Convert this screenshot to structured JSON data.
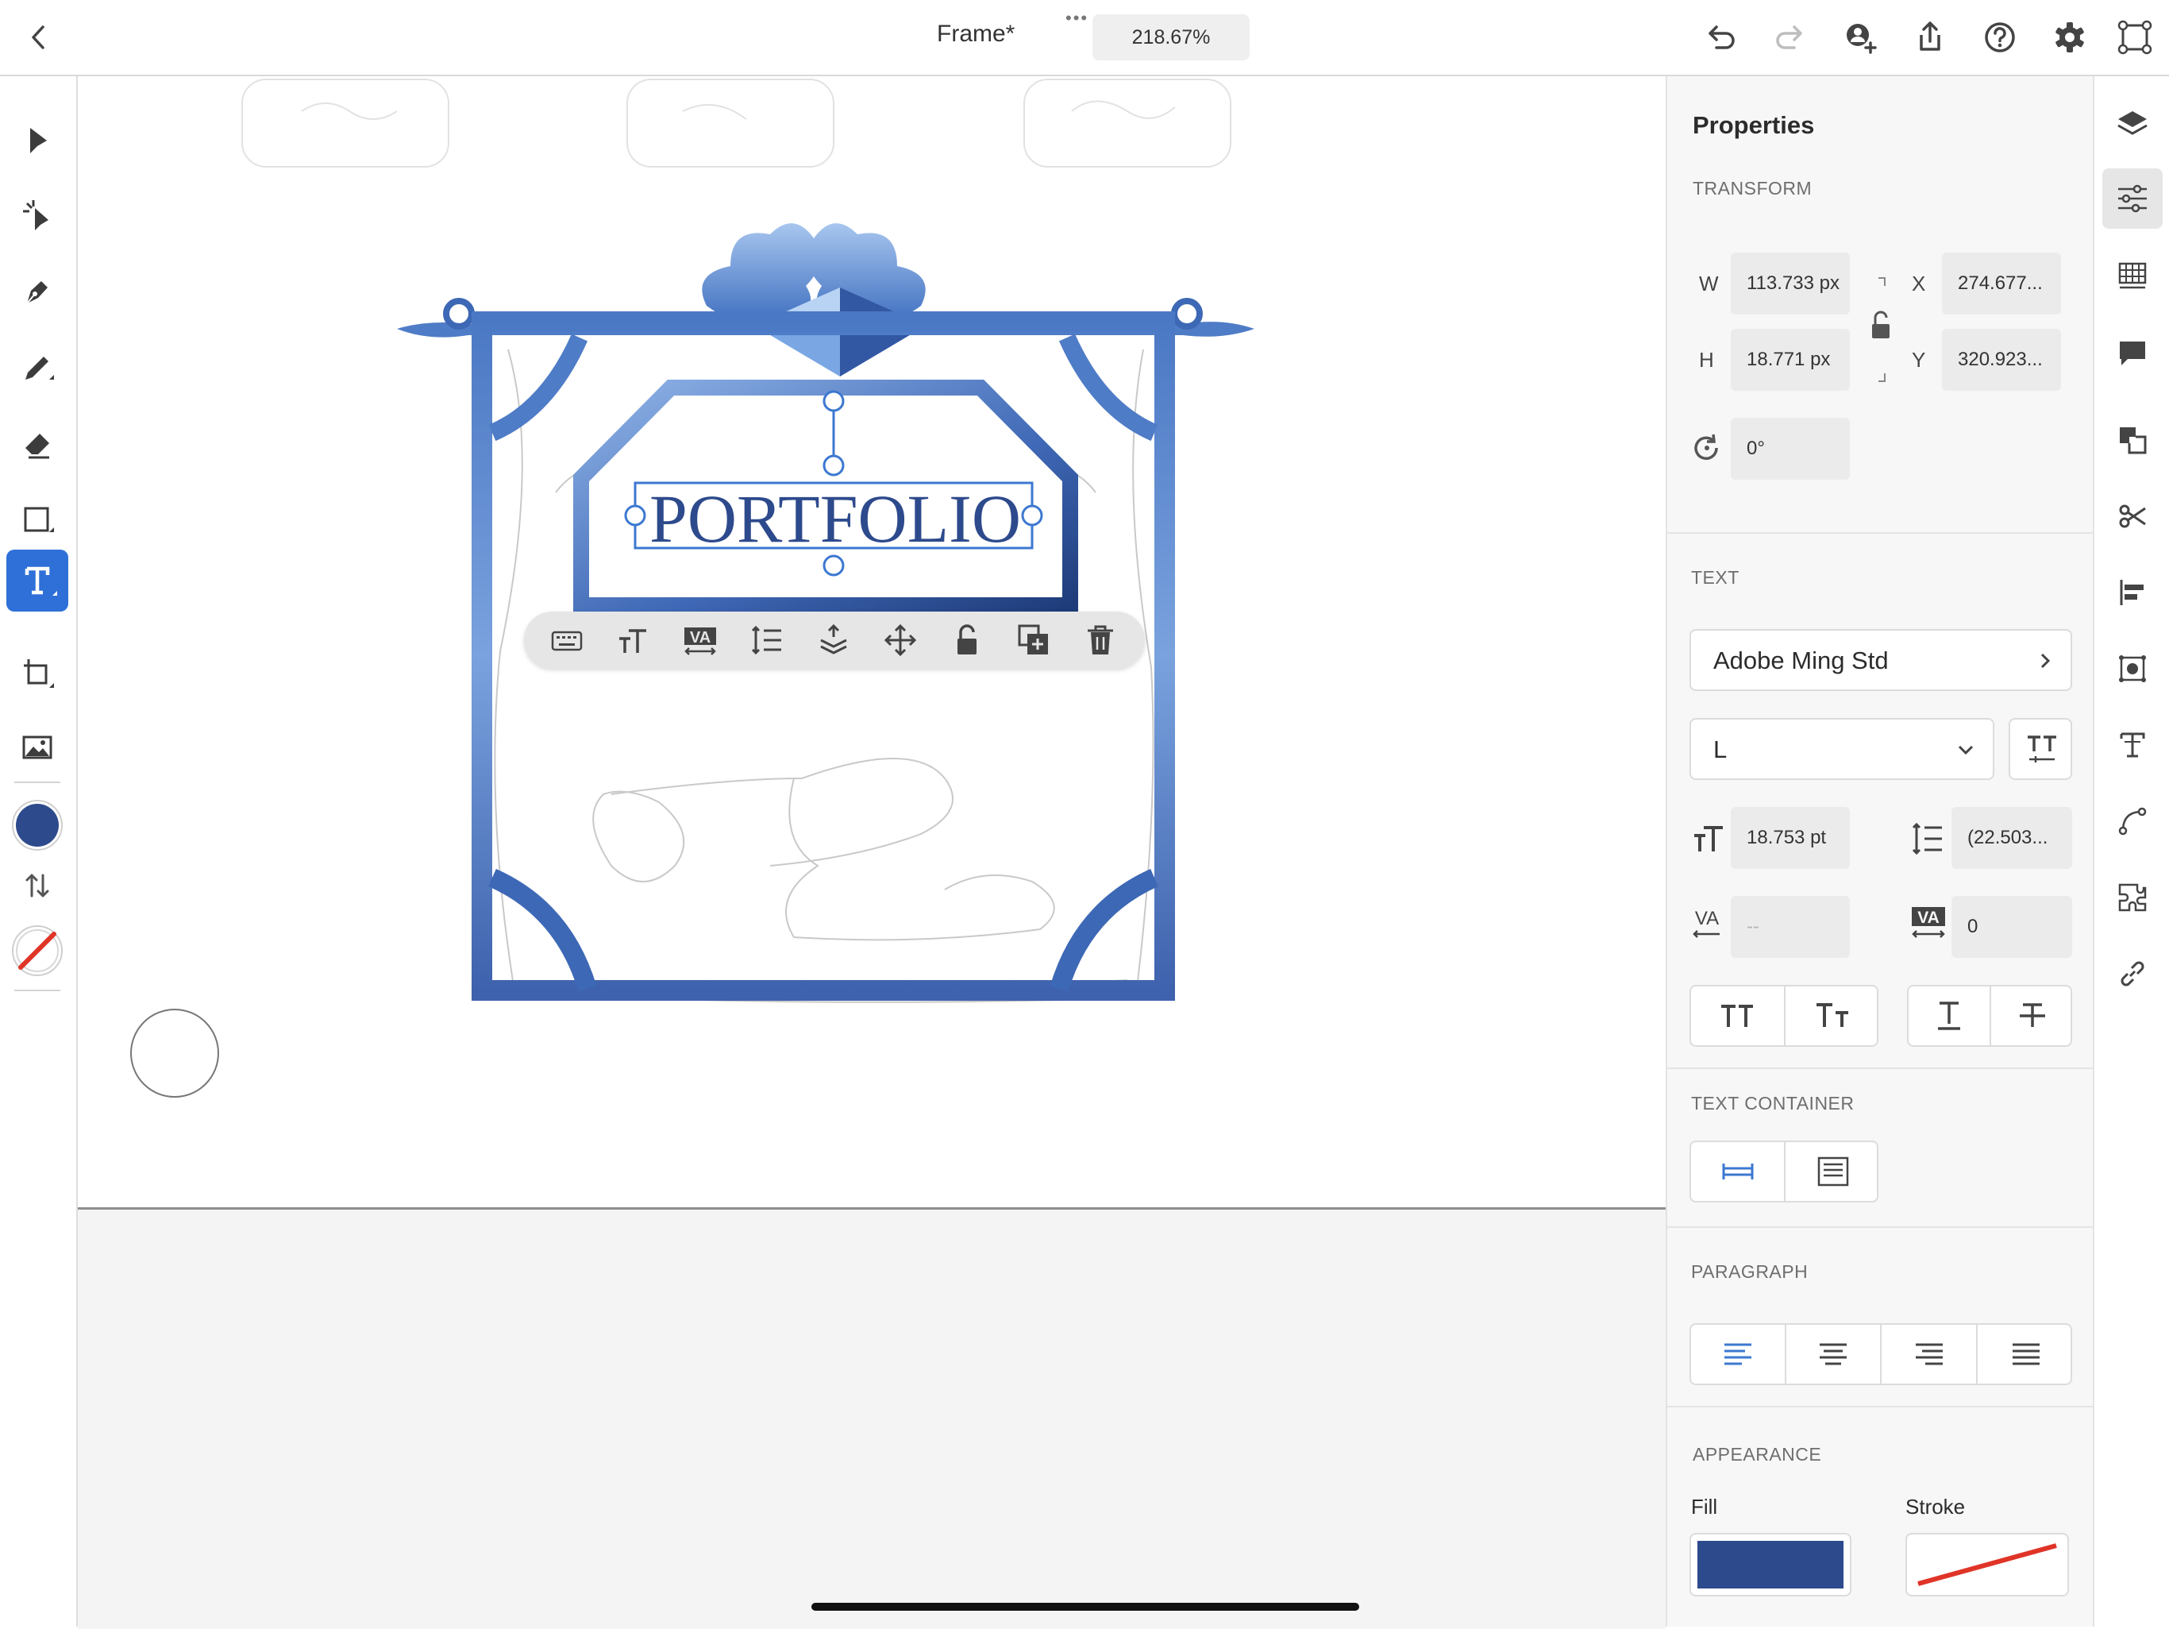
{
  "header": {
    "doc_title": "Frame*",
    "zoom": "218.67%",
    "more": "•••"
  },
  "toolbar_left": {
    "active_tool": "text-tool",
    "fill_color": "#2d4a8c"
  },
  "canvas": {
    "selected_text": "PORTFOLIO",
    "frame_color": "#3d68b5"
  },
  "properties": {
    "title": "Properties",
    "transform": {
      "label": "TRANSFORM",
      "w_label": "W",
      "w_value": "113.733 px",
      "h_label": "H",
      "h_value": "18.771 px",
      "x_label": "X",
      "x_value": "274.677...",
      "y_label": "Y",
      "y_value": "320.923...",
      "rotation": "0°"
    },
    "text": {
      "label": "TEXT",
      "font": "Adobe Ming Std",
      "weight": "L",
      "font_size": "18.753 pt",
      "leading": "(22.503...",
      "kerning": "--",
      "tracking": "0"
    },
    "text_container": {
      "label": "TEXT CONTAINER"
    },
    "paragraph": {
      "label": "PARAGRAPH"
    },
    "appearance": {
      "label": "APPEARANCE",
      "fill_label": "Fill",
      "stroke_label": "Stroke",
      "fill_color": "#2d4a8c",
      "stroke_color": "#e03428"
    }
  },
  "colors": {
    "accent": "#2f70d8",
    "fill": "#2d4a8c",
    "none_stroke": "#e03428"
  }
}
